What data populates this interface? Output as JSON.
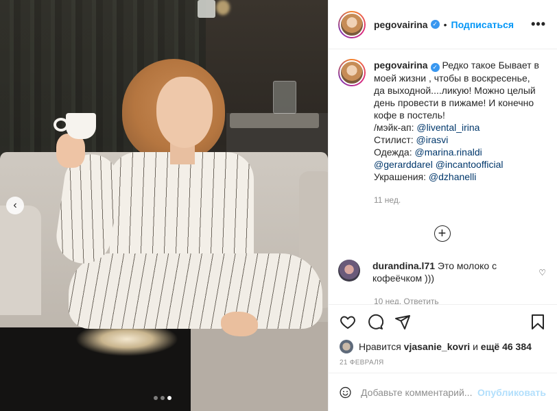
{
  "post": {
    "username": "pegovairina",
    "separator": "•",
    "follow_label": "Подписаться",
    "more_label": "•••",
    "carousel": {
      "active_index": 2,
      "count": 3
    }
  },
  "caption": {
    "username": "pegovairina",
    "lines": [
      "Редко такое Бывает в моей жизни , чтобы в воскресенье, да выходной....ликую! Можно целый день провести в пижаме! И конечно кофе в постель!"
    ],
    "credits": [
      {
        "label": "/мэйк-ап: ",
        "mentions": [
          "@livental_irina"
        ]
      },
      {
        "label": "Стилист: ",
        "mentions": [
          "@irasvi"
        ]
      },
      {
        "label": "Одежда: ",
        "mentions": [
          "@marina.rinaldi"
        ]
      },
      {
        "label": "",
        "mentions": [
          "@gerarddarel",
          "@incantoofficial"
        ]
      },
      {
        "label": "Украшения: ",
        "mentions": [
          "@dzhanelli"
        ]
      }
    ],
    "time": "11 нед."
  },
  "comment": {
    "username": "durandina.l71",
    "text": "Это молоко с кофеёчком )))",
    "meta": "10 нед.    Ответить"
  },
  "likes": {
    "prefix": "Нравится",
    "user": "vjasanie_kovri",
    "middle": "и",
    "count": "ещё 46 384"
  },
  "date": "21 ФЕВРАЛЯ",
  "composer": {
    "placeholder": "Добавьте комментарий...",
    "post_label": "Опубликовать"
  },
  "colors": {
    "link": "#0095f6",
    "mention": "#00376b",
    "muted": "#8e8e8e",
    "post_disabled": "#b2dffc"
  }
}
